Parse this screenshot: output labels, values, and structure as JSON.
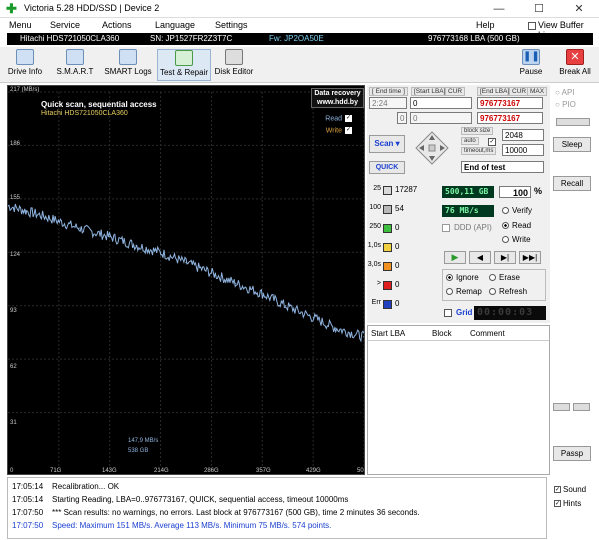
{
  "window": {
    "title": "Victoria 5.28 HDD/SSD | Device 2",
    "controls": [
      "—",
      "☐",
      "✕"
    ]
  },
  "menu": {
    "items": [
      "Menu",
      "Service",
      "Actions",
      "Language",
      "Settings",
      "Help"
    ],
    "view_buffer": "View Buffer Live"
  },
  "infobar": {
    "model": "Hitachi HDS721050CLA360",
    "serial": "SN: JP1527FR2Z3T7C",
    "firmware": "Fw: JP2OA50E",
    "capacity": "976773168 LBA (500 GB)"
  },
  "toolbar": {
    "drive_info": "Drive Info",
    "smart": "S.M.A.R.T",
    "smart_logs": "SMART Logs",
    "test_repair": "Test & Repair",
    "disk_editor": "Disk Editor",
    "pause": "Pause",
    "break_all": "Break All"
  },
  "graph": {
    "title": "Quick scan, sequential access",
    "model": "Hitachi HDS721050CLA360",
    "promo_line1": "Data recovery",
    "promo_line2": "www.hdd.by",
    "legend_read": "Read",
    "legend_write": "Write",
    "y_ticks": [
      "217 (MB/s)",
      "186",
      "155",
      "124",
      "93",
      "62",
      "31"
    ],
    "x_ticks": [
      "0",
      "71G",
      "143G",
      "214G",
      "286G",
      "357G",
      "429G",
      "50"
    ],
    "cursor_speed": "147,9 MB/s",
    "cursor_pos": "538 GB",
    "colors": {
      "read": "#8fb4e0",
      "write": "#d9a040",
      "bg": "#000000"
    }
  },
  "chart_data": {
    "type": "line",
    "title": "Quick scan, sequential access",
    "xlabel": "",
    "ylabel": "MB/s",
    "x_ticks": [
      "0",
      "71G",
      "143G",
      "214G",
      "286G",
      "357G",
      "429G",
      "50"
    ],
    "ylim": [
      0,
      217
    ],
    "series": [
      {
        "name": "Read",
        "x_gb": [
          0,
          25,
          50,
          71,
          100,
          143,
          180,
          214,
          250,
          286,
          320,
          357,
          390,
          429,
          460,
          500
        ],
        "values": [
          151,
          148,
          145,
          142,
          138,
          133,
          128,
          124,
          118,
          112,
          106,
          100,
          93,
          86,
          80,
          75
        ]
      }
    ]
  },
  "panel": {
    "end_time_label": "[ End time ]",
    "start_lba_label": "[Start LBA]",
    "cur_label": "CUR",
    "end_lba_label": "[End LBA]",
    "max_label": "MAX",
    "end_time": "2:24",
    "start_lba": "0",
    "end_lba": "976773167",
    "cur_zero": "0",
    "cur_lba": "0",
    "end_lba2": "976773167",
    "block_size_label": "block size",
    "auto_label": "auto",
    "timeout_label": "timeout,ms",
    "block_size": "2048",
    "timeout": "10000",
    "scan_btn": "Scan",
    "quick_btn": "QUICK",
    "end_of_test": "End of test",
    "counters": [
      {
        "label": "25",
        "value": "17287",
        "color": "#d8d8d8"
      },
      {
        "label": "100",
        "value": "54",
        "color": "#b8b8b8"
      },
      {
        "label": "250",
        "value": "0",
        "color": "#3fbf3f"
      },
      {
        "label": "1,0s",
        "value": "0",
        "color": "#f0d040"
      },
      {
        "label": "3,0s",
        "value": "0",
        "color": "#f09020"
      },
      {
        "label": ">",
        "value": "0",
        "color": "#e02020"
      },
      {
        "label": "Err",
        "value": "0",
        "color": "#2040c0"
      }
    ],
    "gb_readout": "500,11 GB",
    "percent": "100",
    "percent_sign": "%",
    "speed_readout": "76 MB/s",
    "verify": "Verify",
    "read": "Read",
    "write": "Write",
    "ddd_api": "DDD (API)",
    "ignore": "Ignore",
    "erase": "Erase",
    "remap": "Remap",
    "refresh": "Refresh",
    "grid": "Grid",
    "timer": "00:00:03",
    "log_cols": [
      "Start LBA",
      "Block",
      "Comment"
    ]
  },
  "side": {
    "api": "API",
    "pio": "PIO",
    "sleep": "Sleep",
    "recall": "Recall",
    "passp": "Passp"
  },
  "log": {
    "lines": [
      {
        "time": "17:05:14",
        "text": "Recalibration... OK",
        "color": "#000000"
      },
      {
        "time": "17:05:14",
        "text": "Starting Reading, LBA=0..976773167, QUICK, sequential access, timeout 10000ms",
        "color": "#000000"
      },
      {
        "time": "17:07:50",
        "text": "*** Scan results: no warnings, no errors. Last block at 976773167 (500 GB), time 2 minutes 36 seconds.",
        "color": "#000000"
      },
      {
        "time": "17:07:50",
        "text": "Speed: Maximum 151 MB/s. Average 113 MB/s. Minimum 75 MB/s. 574 points.",
        "color": "#1a3fd0"
      }
    ],
    "sound": "Sound",
    "hints": "Hints"
  }
}
